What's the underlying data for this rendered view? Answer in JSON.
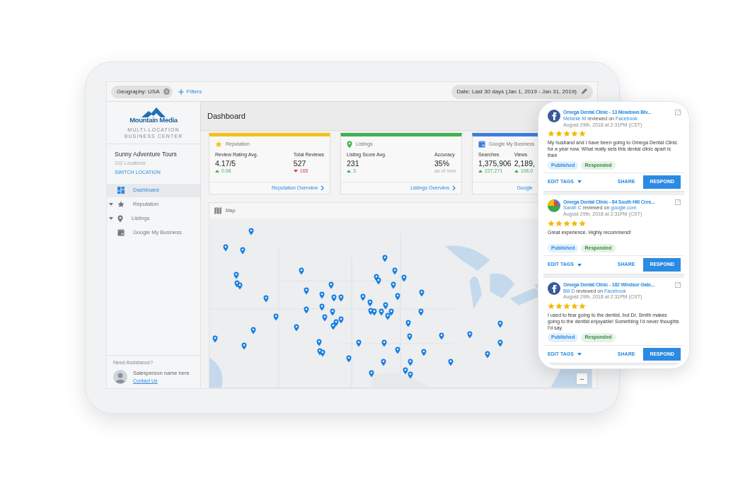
{
  "filter_bar": {
    "chips": [
      {
        "label": "Geography: USA"
      }
    ],
    "add_label": "Filters",
    "date": "Date: Last 30 days (Jan 1, 2019 - Jan 31, 2019)"
  },
  "sidebar": {
    "brand": "Mountain Media",
    "tagline": "MULTI-LOCATION BUSINESS CENTER",
    "account": {
      "name": "Sunny Adventure Tours",
      "locations": "102 Locations",
      "switch_label": "SWITCH LOCATION"
    },
    "nav": [
      {
        "label": "Dashboard",
        "selected": true,
        "expandable": false
      },
      {
        "label": "Reputation",
        "selected": false,
        "expandable": true
      },
      {
        "label": "Listings",
        "selected": false,
        "expandable": true
      },
      {
        "label": "Google My Business",
        "selected": false,
        "expandable": false
      }
    ],
    "assistance": {
      "heading": "Need Assistance?",
      "name": "Salesperson name here",
      "link": "Contact Us"
    }
  },
  "page_title": "Dashboard",
  "cards": [
    {
      "title": "Reputation",
      "color": "#f2c21b",
      "link": "Reputation Overview",
      "metrics": [
        {
          "label": "Review Rating Avg.",
          "value": "4.17/5",
          "change": "0.06",
          "up": true
        },
        {
          "label": "Total Reviews",
          "value": "527",
          "change": "165",
          "up": false
        }
      ]
    },
    {
      "title": "Listings",
      "color": "#3fb34f",
      "link": "Listings Overview",
      "metrics": [
        {
          "label": "Listing Score Avg.",
          "value": "231",
          "change": "3",
          "up": true
        },
        {
          "label": "Accuracy",
          "value": "35%",
          "note": "as of now"
        }
      ]
    },
    {
      "title": "Google My Business",
      "color": "#3d7ddc",
      "link": "Google",
      "metrics": [
        {
          "label": "Searches",
          "value": "1,375,906",
          "change": "227,271",
          "up": true
        },
        {
          "label": "Views",
          "value": "2,189,",
          "change": "106,0",
          "up": true
        }
      ]
    }
  ],
  "map": {
    "title": "Map",
    "zoom_out": "−"
  },
  "reviews": [
    {
      "kind": "facebook",
      "title": "Omega Dental Clinic - 13 Meadows Blv...",
      "reviewer": "Melanie M",
      "verb": "reviewed on",
      "site": "Facebook",
      "date": "August 29th, 2018 at 2:31PM (CST)",
      "stars": 5,
      "text": "My husband and I have been going to Omega Dental Clinic for a year now. What really sets this dental clinic apart is their",
      "tags": [
        {
          "label": "Published",
          "kind": "published"
        },
        {
          "label": "Responded",
          "kind": "responded"
        }
      ],
      "edit_label": "EDIT TAGS",
      "share_label": "SHARE",
      "respond_label": "RESPOND"
    },
    {
      "kind": "google",
      "title": "Omega Dental Clinic - 84 South Hill Cres...",
      "reviewer": "Sarah C",
      "verb": "reviewed on",
      "site": "google.com",
      "date": "August 29th, 2018 at 2:31PM (CST)",
      "stars": 5,
      "text": "Great experience. Highly recommend!",
      "tags": [
        {
          "label": "Published",
          "kind": "published"
        },
        {
          "label": "Responded",
          "kind": "responded"
        }
      ],
      "edit_label": "EDIT TAGS",
      "share_label": "SHARE",
      "respond_label": "RESPOND"
    },
    {
      "kind": "facebook",
      "title": "Omega Dental Clinic - 182 Windsor Gate...",
      "reviewer": "Bill D",
      "verb": "reviewed on",
      "site": "Facebook",
      "date": "August 29th, 2018 at 2:31PM (CST)",
      "stars": 5,
      "text": "I used to fear going to the dentist, but Dr. Smith makes going to the dentist enjoyable! Something I'd never thoughts I'd say.",
      "tags": [
        {
          "label": "Published",
          "kind": "published"
        },
        {
          "label": "Responded",
          "kind": "responded"
        }
      ],
      "edit_label": "EDIT TAGS",
      "share_label": "SHARE",
      "respond_label": "RESPOND"
    }
  ]
}
